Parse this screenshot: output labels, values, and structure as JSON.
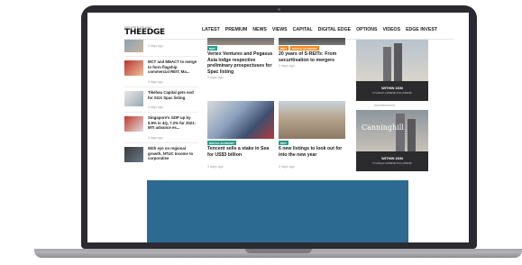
{
  "header": {
    "logo_tag": "FOCUSED ON ASIA",
    "logo": "THEEDGE",
    "nav": [
      "LATEST",
      "PREMIUM",
      "NEWS",
      "VIEWS",
      "CAPITAL",
      "DIGITAL EDGE",
      "OPTIONS",
      "VIDEOS",
      "EDGE INVEST"
    ]
  },
  "left_list": [
    {
      "title": "",
      "time": "3 days ago"
    },
    {
      "title": "MCT and MNACT to merge to form flagship commercial REIT, Ma...",
      "time": "3 days ago"
    },
    {
      "title": "Tikehau Capital gets nod for SGX Spac listing",
      "time": "3 days ago"
    },
    {
      "title": "Singapore's GDP up by 5.9% in 4Q, 7.2% for 2021: MTI advance es...",
      "time": "3 days ago"
    },
    {
      "title": "With eye on regional growth, NTUC Income to corporatise",
      "time": ""
    }
  ],
  "cards": [
    {
      "tags": [
        "REIT"
      ],
      "tag_colors": [
        "#2a9d8f"
      ],
      "title": "Vertex Ventures and Pegasus Asia lodge respective preliminary prospectuses for Spac listing",
      "time": "3 days ago"
    },
    {
      "tags": [
        "REIT",
        "DIGITAL ECONOMY"
      ],
      "tag_colors": [
        "#f08a24",
        "#f08a24"
      ],
      "title": "20 years of S-REITs: From securitisation to mergers",
      "time": "3 days ago"
    },
    {
      "tags": [
        "DIGITAL ECONOMY"
      ],
      "tag_colors": [
        "#2a9d8f"
      ],
      "title": "Tencent sells a stake in Sea for US$3 billion",
      "time": "3 days ago"
    },
    {
      "tags": [
        "REIT"
      ],
      "tag_colors": [
        "#2a9d8f"
      ],
      "title": "6 new listings to look out for into the new year",
      "time": "3 days ago"
    }
  ],
  "ads": [
    {
      "label": "",
      "within": "WITHIN 1KM",
      "small": "TO ANGLO-CHINESE SCH (JUNIOR)",
      "brand": ""
    },
    {
      "label": "Advertisement",
      "within": "WITHIN 1KM",
      "small": "TO ANGLO-CHINESE SCH (JUNIOR)",
      "brand": "Canninghill"
    }
  ],
  "colors": {
    "accent": "#2a9d8f",
    "orange": "#f08a24",
    "slate": "#2d6a91",
    "laptop": "#2a2a30"
  }
}
